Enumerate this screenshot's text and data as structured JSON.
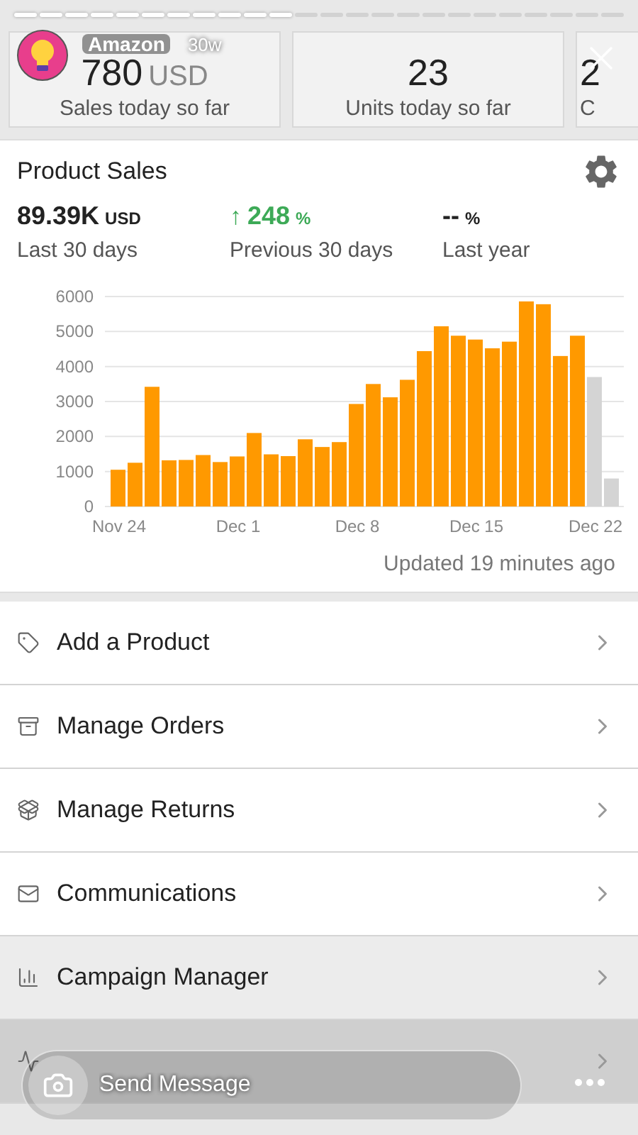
{
  "story": {
    "username": "Amazon",
    "age": "30w",
    "segments": [
      {
        "watched": true
      },
      {
        "watched": true
      },
      {
        "watched": true
      },
      {
        "watched": true
      },
      {
        "watched": true
      },
      {
        "watched": true
      },
      {
        "watched": true
      },
      {
        "watched": true
      },
      {
        "watched": true
      },
      {
        "watched": true
      },
      {
        "watched": true
      },
      {
        "watched": false
      },
      {
        "watched": false
      },
      {
        "watched": false
      },
      {
        "watched": false
      },
      {
        "watched": false
      },
      {
        "watched": false
      },
      {
        "watched": false
      },
      {
        "watched": false
      },
      {
        "watched": false
      },
      {
        "watched": false
      },
      {
        "watched": false
      },
      {
        "watched": false
      },
      {
        "watched": false
      }
    ]
  },
  "stat_cards": [
    {
      "value": "780",
      "unit": "USD",
      "label": "Sales today so far"
    },
    {
      "value": "23",
      "label": "Units today so far"
    },
    {
      "value": "2",
      "label": "C"
    }
  ],
  "product_sales": {
    "title": "Product Sales",
    "metrics": [
      {
        "kind": "total",
        "value": "89.39K",
        "unit": "USD",
        "label": "Last 30 days"
      },
      {
        "kind": "up",
        "arrow": "↑",
        "value": "248",
        "unit": "%",
        "label": "Previous 30 days"
      },
      {
        "kind": "plain",
        "value": "--",
        "unit": "%",
        "label": "Last year"
      }
    ],
    "x_axis_labels": [
      "Nov 24",
      "Dec 1",
      "Dec 8",
      "Dec 15",
      "Dec 22"
    ],
    "chart_data": {
      "type": "bar",
      "grid": true,
      "series": [
        {
          "color": "#ff9900",
          "values": [
            1050,
            1250,
            3420,
            1320,
            1330,
            1470,
            1270,
            1430,
            2100,
            1490,
            1440,
            1920,
            1700,
            1840,
            2930,
            3500,
            3120,
            3620,
            4440,
            5150,
            4880,
            4770,
            4520,
            4710,
            5860,
            5780,
            4300,
            4880,
            null,
            null
          ]
        },
        {
          "color": "#d4d4d4",
          "values": [
            null,
            null,
            null,
            null,
            null,
            null,
            null,
            null,
            null,
            null,
            null,
            null,
            null,
            null,
            null,
            null,
            null,
            null,
            null,
            null,
            null,
            null,
            null,
            null,
            null,
            null,
            null,
            null,
            3700,
            800
          ]
        }
      ],
      "ylim": [
        0,
        6000
      ],
      "yticks": [
        0,
        1000,
        2000,
        3000,
        4000,
        5000,
        6000
      ]
    },
    "updated": "Updated 19 minutes ago"
  },
  "menu": [
    {
      "kind": "add",
      "label": "Add a Product"
    },
    {
      "kind": "orders",
      "label": "Manage Orders"
    },
    {
      "kind": "returns",
      "label": "Manage Returns"
    },
    {
      "kind": "mail",
      "label": "Communications"
    },
    {
      "kind": "campaign",
      "label": "Campaign Manager"
    },
    {
      "kind": "health"
    }
  ],
  "message_bar": {
    "placeholder": "Send Message"
  }
}
